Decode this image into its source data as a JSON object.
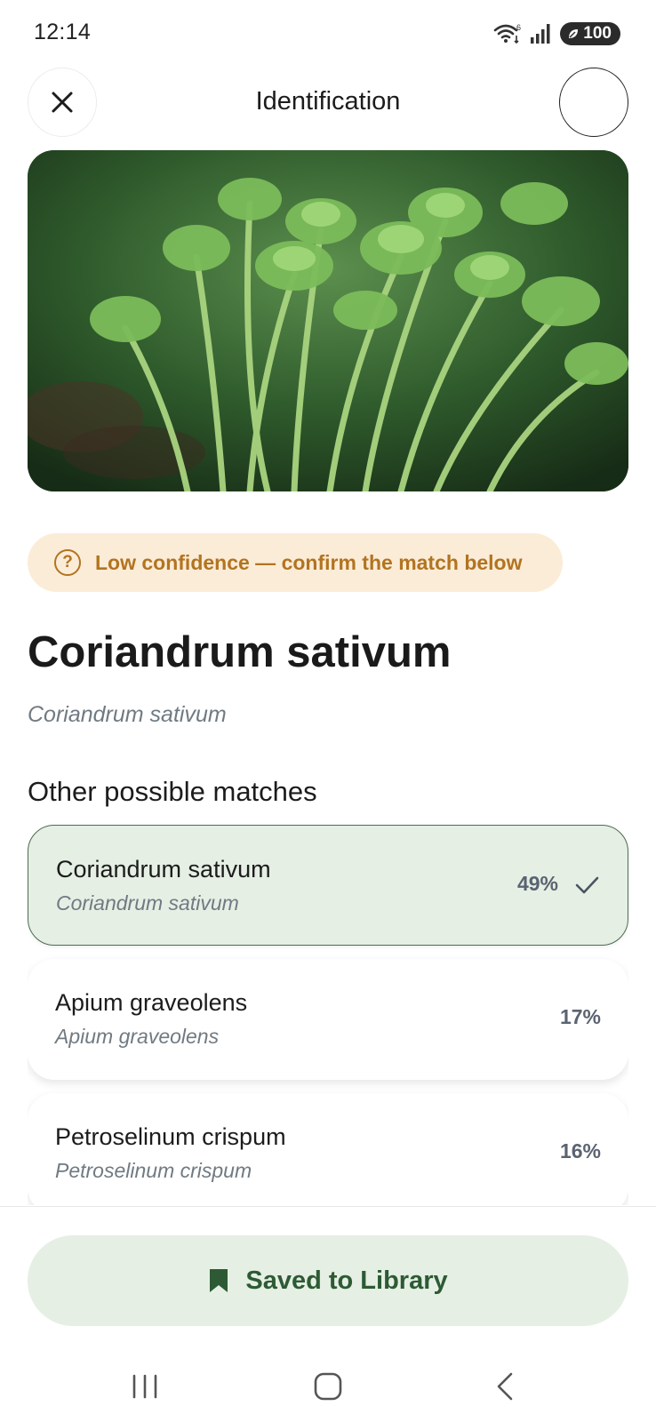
{
  "status_bar": {
    "time": "12:14",
    "battery": "100",
    "icons": [
      "wifi-icon",
      "signal-icon",
      "battery-icon"
    ]
  },
  "header": {
    "title": "Identification",
    "close_icon": "close-icon"
  },
  "photo": {
    "subject": "cilantro-plant-photo"
  },
  "confidence": {
    "text": "Low confidence — confirm the match below",
    "icon": "question-icon",
    "color": "#b27420",
    "background": "#fbecd8"
  },
  "result": {
    "name": "Coriandrum sativum",
    "scientific_name": "Coriandrum sativum"
  },
  "matches": {
    "title": "Other possible matches",
    "items": [
      {
        "name": "Coriandrum sativum",
        "scientific_name": "Coriandrum sativum",
        "percent": "49%",
        "selected": true
      },
      {
        "name": "Apium graveolens",
        "scientific_name": "Apium graveolens",
        "percent": "17%",
        "selected": false
      },
      {
        "name": "Petroselinum crispum",
        "scientific_name": "Petroselinum crispum",
        "percent": "16%",
        "selected": false
      }
    ]
  },
  "save_button": {
    "label": "Saved to Library",
    "icon": "bookmark-icon",
    "accent": "#2d5a34",
    "background": "#e5efe4"
  },
  "nav_bar": {
    "icons": [
      "recents-icon",
      "home-icon",
      "back-icon"
    ]
  }
}
